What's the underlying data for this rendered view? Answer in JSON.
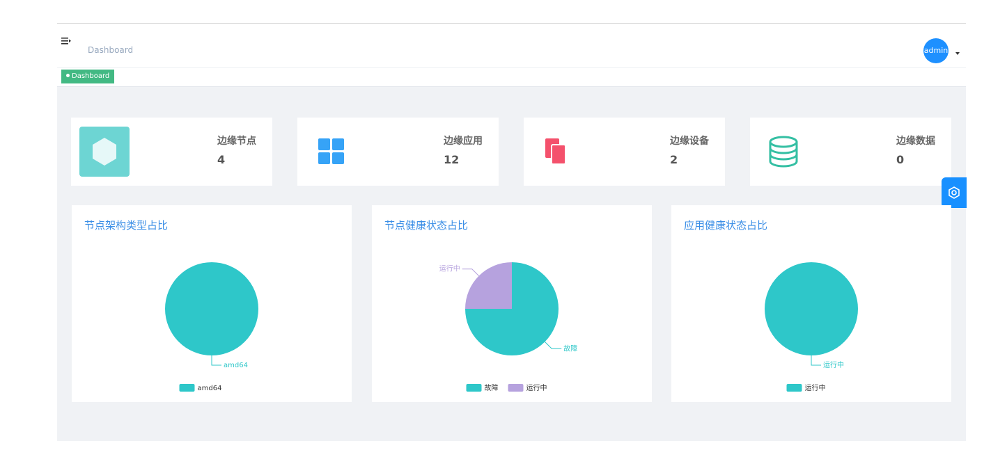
{
  "navbar": {
    "breadcrumb": "Dashboard",
    "user": "admin"
  },
  "tags": [
    {
      "label": "Dashboard",
      "active": true
    }
  ],
  "stats": [
    {
      "label": "边缘节点",
      "value": "4",
      "icon": "hexagon-icon",
      "color": "#6dd5d3"
    },
    {
      "label": "边缘应用",
      "value": "12",
      "icon": "grid-icon",
      "color": "#36a3f7"
    },
    {
      "label": "边缘设备",
      "value": "2",
      "icon": "copy-icon",
      "color": "#f4516c"
    },
    {
      "label": "边缘数据",
      "value": "0",
      "icon": "database-icon",
      "color": "#34bfa3"
    }
  ],
  "charts": {
    "arch": {
      "title": "节点架构类型占比"
    },
    "node_health": {
      "title": "节点健康状态占比"
    },
    "app_health": {
      "title": "应用健康状态占比"
    }
  },
  "colors": {
    "teal": "#2ec7c9",
    "purple": "#b6a2de",
    "active_tag": "#42b983",
    "accent": "#1890ff"
  },
  "chart_data": [
    {
      "type": "pie",
      "title": "节点架构类型占比",
      "slices": [
        {
          "name": "amd64",
          "value": 1
        }
      ],
      "legend": [
        "amd64"
      ],
      "legend_position": "bottom"
    },
    {
      "type": "pie",
      "title": "节点健康状态占比",
      "slices": [
        {
          "name": "故障",
          "value": 3
        },
        {
          "name": "运行中",
          "value": 1
        }
      ],
      "legend": [
        "故障",
        "运行中"
      ],
      "legend_position": "bottom"
    },
    {
      "type": "pie",
      "title": "应用健康状态占比",
      "slices": [
        {
          "name": "运行中",
          "value": 1
        }
      ],
      "legend": [
        "运行中"
      ],
      "legend_position": "bottom"
    }
  ]
}
